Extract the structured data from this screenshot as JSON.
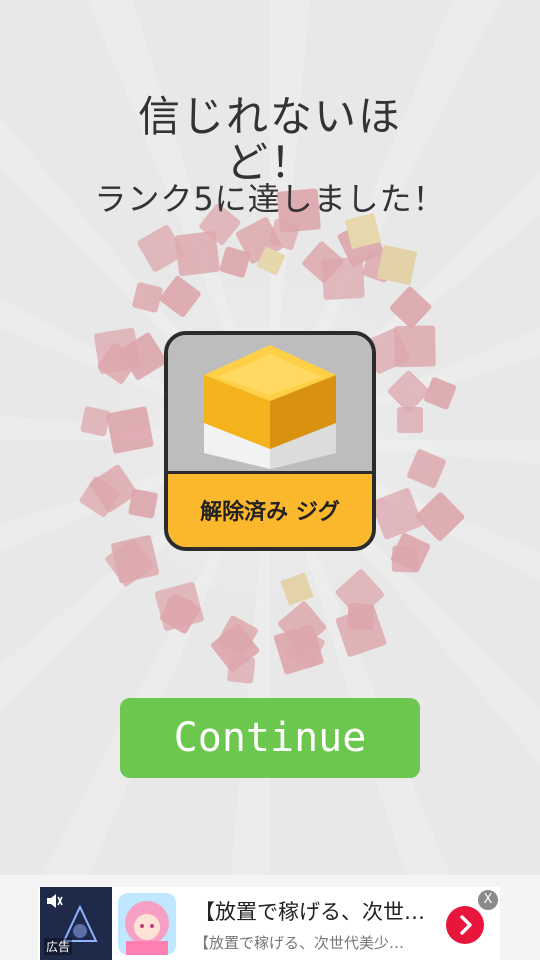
{
  "result": {
    "title": "信じれないほど！",
    "subtitle": "ランク5に達しました！"
  },
  "unlock": {
    "label": "解除済み ジグ",
    "block_color": "#fbb82c"
  },
  "actions": {
    "continue_label": "Continue"
  },
  "ad": {
    "badge": "広告",
    "title": "【放置で稼げる、次世…",
    "description": "【放置で稼げる、次世代美少…",
    "close_label": "X",
    "icons": [
      "speaker-mute-icon",
      "chevron-right-icon",
      "close-icon"
    ]
  },
  "colors": {
    "accent_green": "#6cc74e",
    "accent_yellow": "#fbb82c",
    "ad_red": "#e8163c",
    "block_red": "#c72a3a"
  }
}
